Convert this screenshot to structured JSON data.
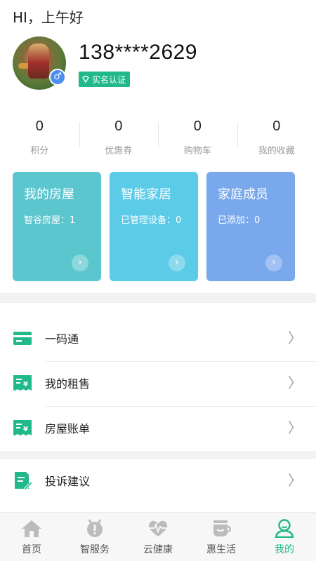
{
  "greeting": "HI，上午好",
  "user": {
    "phone": "138****2629",
    "verify_label": "实名认证",
    "gender_symbol": "♂"
  },
  "stats": [
    {
      "value": "0",
      "label": "积分"
    },
    {
      "value": "0",
      "label": "优惠券"
    },
    {
      "value": "0",
      "label": "购物车"
    },
    {
      "value": "0",
      "label": "我的收藏"
    }
  ],
  "cards": [
    {
      "title": "我的房屋",
      "sub": "智谷房屋：1",
      "color": "#5cc6cf"
    },
    {
      "title": "智能家居",
      "sub": "已管理设备：0",
      "color": "#5ccbe8"
    },
    {
      "title": "家庭成员",
      "sub": "已添加：0",
      "color": "#79a8ec"
    }
  ],
  "menu": [
    {
      "label": "一码通",
      "icon": "card-icon"
    },
    {
      "label": "我的租售",
      "icon": "receipt-yen-icon"
    },
    {
      "label": "房屋账单",
      "icon": "bill-yen-icon"
    },
    {
      "label": "投诉建议",
      "icon": "feedback-edit-icon"
    }
  ],
  "tabs": [
    {
      "label": "首页",
      "icon": "home-icon"
    },
    {
      "label": "智服务",
      "icon": "service-icon"
    },
    {
      "label": "云健康",
      "icon": "health-icon"
    },
    {
      "label": "惠生活",
      "icon": "cup-icon"
    },
    {
      "label": "我的",
      "icon": "user-icon"
    }
  ],
  "colors": {
    "accent": "#22b98a",
    "tab_inactive": "#bcbcbc"
  }
}
